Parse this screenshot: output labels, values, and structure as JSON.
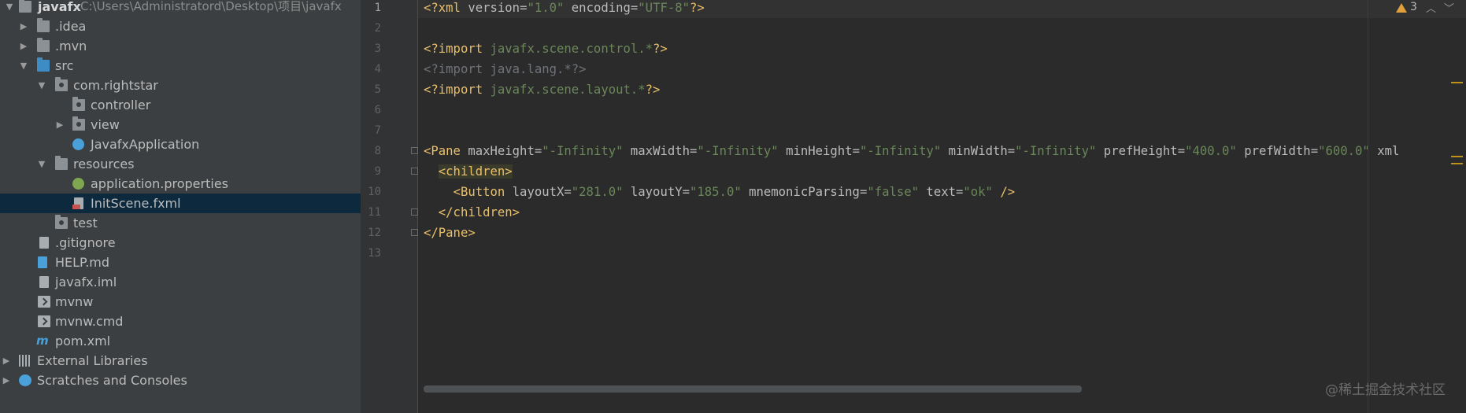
{
  "project_tree": {
    "root": {
      "label": "javafx",
      "path": "C:\\Users\\Administratord\\Desktop\\项目\\javafx"
    },
    "items": [
      {
        "label": ".idea"
      },
      {
        "label": ".mvn"
      },
      {
        "label": "src"
      },
      {
        "label": "com.rightstar"
      },
      {
        "label": "controller"
      },
      {
        "label": "view"
      },
      {
        "label": "JavafxApplication"
      },
      {
        "label": "resources"
      },
      {
        "label": "application.properties"
      },
      {
        "label": "InitScene.fxml"
      },
      {
        "label": "test"
      },
      {
        "label": ".gitignore"
      },
      {
        "label": "HELP.md"
      },
      {
        "label": "javafx.iml"
      },
      {
        "label": "mvnw"
      },
      {
        "label": "mvnw.cmd"
      },
      {
        "label": "pom.xml"
      },
      {
        "label": "External Libraries"
      },
      {
        "label": "Scratches and Consoles"
      }
    ],
    "selected": "InitScene.fxml"
  },
  "editor": {
    "line_numbers": [
      "1",
      "2",
      "3",
      "4",
      "5",
      "6",
      "7",
      "8",
      "9",
      "10",
      "11",
      "12",
      "13"
    ],
    "current_line": "1",
    "warnings_count": "3",
    "lines": {
      "l1": {
        "open": "<?xml ",
        "a1": "version",
        "eq1": "=",
        "v1": "\"1.0\"",
        "sp": " ",
        "a2": "encoding",
        "eq2": "=",
        "v2": "\"UTF-8\"",
        "close": "?>"
      },
      "l3": {
        "kw": "<?import ",
        "pkg": "javafx.scene.control.*",
        "close": "?>"
      },
      "l4": {
        "text": "<?import java.lang.*?>"
      },
      "l5": {
        "kw": "<?import ",
        "pkg": "javafx.scene.layout.*",
        "close": "?>"
      },
      "l8": {
        "tag": "<Pane",
        "a1": " maxHeight",
        "v1": "\"-Infinity\"",
        "a2": " maxWidth",
        "v2": "\"-Infinity\"",
        "a3": " minHeight",
        "v3": "\"-Infinity\"",
        "a4": " minWidth",
        "v4": "\"-Infinity\"",
        "a5": " prefHeight",
        "v5": "\"400.0\"",
        "a6": " prefWidth",
        "v6": "\"600.0\"",
        "a7": " xml",
        "eq": "="
      },
      "l9": {
        "tag": "<children>"
      },
      "l10": {
        "tag": "<Button",
        "a1": " layoutX",
        "v1": "\"281.0\"",
        "a2": " layoutY",
        "v2": "\"185.0\"",
        "a3": " mnemonicParsing",
        "v3": "\"false\"",
        "a4": " text",
        "v4": "\"ok\"",
        "close": " />",
        "eq": "="
      },
      "l11": {
        "tag": "</children>"
      },
      "l12": {
        "tag": "</Pane>"
      }
    }
  },
  "watermark": "@稀土掘金技术社区",
  "colors": {
    "tree_bg": "#3c3f41",
    "editor_bg": "#2b2b2b",
    "selection": "#0d293e",
    "tag": "#e8bf6a",
    "string": "#6a8759",
    "attr": "#bababa",
    "warning": "#e0a03a"
  }
}
